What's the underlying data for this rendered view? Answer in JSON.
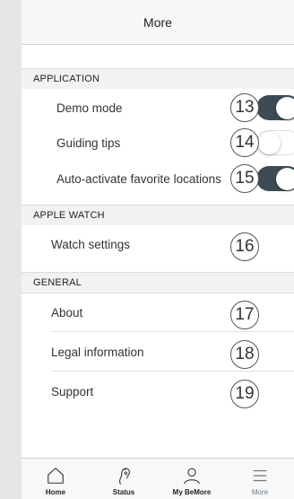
{
  "navbar": {
    "title": "More"
  },
  "sections": {
    "application": {
      "header": "APPLICATION",
      "rows": [
        {
          "label": "Demo mode",
          "callout": "13",
          "toggle": true
        },
        {
          "label": "Guiding tips",
          "callout": "14",
          "toggle": false
        },
        {
          "label": "Auto-activate favorite locations",
          "callout": "15",
          "toggle": true
        }
      ]
    },
    "apple_watch": {
      "header": "APPLE WATCH",
      "rows": [
        {
          "label": "Watch settings",
          "callout": "16"
        }
      ]
    },
    "general": {
      "header": "GENERAL",
      "rows": [
        {
          "label": "About",
          "callout": "17"
        },
        {
          "label": "Legal information",
          "callout": "18"
        },
        {
          "label": "Support",
          "callout": "19"
        }
      ]
    }
  },
  "tabbar": {
    "tabs": [
      {
        "label": "Home",
        "icon": "house-icon"
      },
      {
        "label": "Status",
        "icon": "ear-icon"
      },
      {
        "label": "My BeMore",
        "icon": "person-icon"
      },
      {
        "label": "More",
        "icon": "menu-icon",
        "active": true
      }
    ]
  },
  "colors": {
    "toggle_on": "#3d4b55",
    "active_tab": "#6a7a86"
  }
}
